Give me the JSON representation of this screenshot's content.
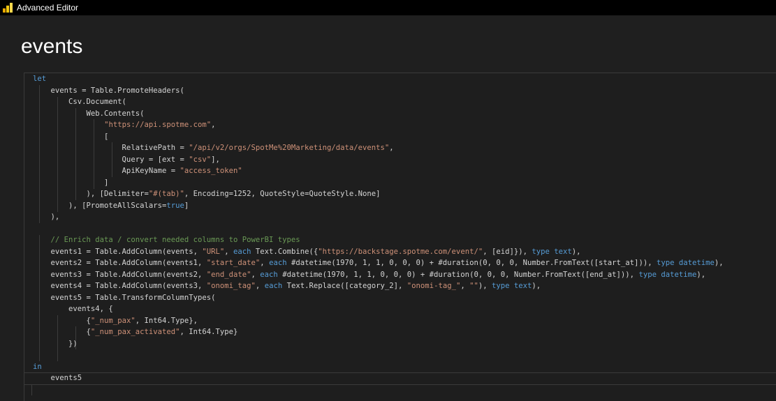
{
  "window": {
    "title": "Advanced Editor",
    "query_name": "events"
  },
  "colors": {
    "keyword": "#569cd6",
    "string": "#ce9178",
    "comment": "#6a9955",
    "text": "#d4d4d4",
    "background": "#1e1e1e",
    "titlebar": "#000000",
    "logo_accent": "#f2c811"
  },
  "icons": {
    "app": "powerbi-logo-icon"
  },
  "code": {
    "lines": [
      [
        {
          "t": "let",
          "c": "kw"
        }
      ],
      [
        {
          "t": "    events = Table.PromoteHeaders("
        }
      ],
      [
        {
          "t": "        Csv.Document("
        }
      ],
      [
        {
          "t": "            Web.Contents("
        }
      ],
      [
        {
          "t": "                "
        },
        {
          "t": "\"https://api.spotme.com\"",
          "c": "str"
        },
        {
          "t": ","
        }
      ],
      [
        {
          "t": "                ["
        }
      ],
      [
        {
          "t": "                    RelativePath = "
        },
        {
          "t": "\"/api/v2/orgs/SpotMe%20Marketing/data/events\"",
          "c": "str"
        },
        {
          "t": ","
        }
      ],
      [
        {
          "t": "                    Query = [ext = "
        },
        {
          "t": "\"csv\"",
          "c": "str"
        },
        {
          "t": "],"
        }
      ],
      [
        {
          "t": "                    ApiKeyName = "
        },
        {
          "t": "\"access_token\"",
          "c": "str"
        }
      ],
      [
        {
          "t": "                ]"
        }
      ],
      [
        {
          "t": "            ), [Delimiter="
        },
        {
          "t": "\"#(tab)\"",
          "c": "str"
        },
        {
          "t": ", Encoding=1252, QuoteStyle=QuoteStyle.None]"
        }
      ],
      [
        {
          "t": "        ), [PromoteAllScalars="
        },
        {
          "t": "true",
          "c": "kw"
        },
        {
          "t": "]"
        }
      ],
      [
        {
          "t": "    ),"
        }
      ],
      [
        {
          "t": ""
        }
      ],
      [
        {
          "t": "    "
        },
        {
          "t": "// Enrich data / convert needed columns to PowerBI types",
          "c": "cm"
        }
      ],
      [
        {
          "t": "    events1 = Table.AddColumn(events, "
        },
        {
          "t": "\"URL\"",
          "c": "str"
        },
        {
          "t": ", "
        },
        {
          "t": "each",
          "c": "kw"
        },
        {
          "t": " Text.Combine({"
        },
        {
          "t": "\"https://backstage.spotme.com/event/\"",
          "c": "str"
        },
        {
          "t": ", [eid]}), "
        },
        {
          "t": "type text",
          "c": "kw"
        },
        {
          "t": "),"
        }
      ],
      [
        {
          "t": "    events2 = Table.AddColumn(events1, "
        },
        {
          "t": "\"start_date\"",
          "c": "str"
        },
        {
          "t": ", "
        },
        {
          "t": "each",
          "c": "kw"
        },
        {
          "t": " #datetime(1970, 1, 1, 0, 0, 0) + #duration(0, 0, 0, Number.FromText([start_at])), "
        },
        {
          "t": "type datetime",
          "c": "kw"
        },
        {
          "t": "),"
        }
      ],
      [
        {
          "t": "    events3 = Table.AddColumn(events2, "
        },
        {
          "t": "\"end_date\"",
          "c": "str"
        },
        {
          "t": ", "
        },
        {
          "t": "each",
          "c": "kw"
        },
        {
          "t": " #datetime(1970, 1, 1, 0, 0, 0) + #duration(0, 0, 0, Number.FromText([end_at])), "
        },
        {
          "t": "type datetime",
          "c": "kw"
        },
        {
          "t": "),"
        }
      ],
      [
        {
          "t": "    events4 = Table.AddColumn(events3, "
        },
        {
          "t": "\"onomi_tag\"",
          "c": "str"
        },
        {
          "t": ", "
        },
        {
          "t": "each",
          "c": "kw"
        },
        {
          "t": " Text.Replace([category_2], "
        },
        {
          "t": "\"onomi-tag_\"",
          "c": "str"
        },
        {
          "t": ", "
        },
        {
          "t": "\"\"",
          "c": "str"
        },
        {
          "t": "), "
        },
        {
          "t": "type text",
          "c": "kw"
        },
        {
          "t": "),"
        }
      ],
      [
        {
          "t": "    events5 = Table.TransformColumnTypes("
        }
      ],
      [
        {
          "t": "        events4, {"
        }
      ],
      [
        {
          "t": "            {"
        },
        {
          "t": "\"_num_pax\"",
          "c": "str"
        },
        {
          "t": ", Int64.Type},"
        }
      ],
      [
        {
          "t": "            {"
        },
        {
          "t": "\"_num_pax_activated\"",
          "c": "str"
        },
        {
          "t": ", Int64.Type}"
        }
      ],
      [
        {
          "t": "        })"
        }
      ],
      [
        {
          "t": ""
        }
      ],
      [
        {
          "t": "in",
          "c": "kw"
        }
      ],
      [
        {
          "t": "    events5"
        }
      ]
    ]
  }
}
